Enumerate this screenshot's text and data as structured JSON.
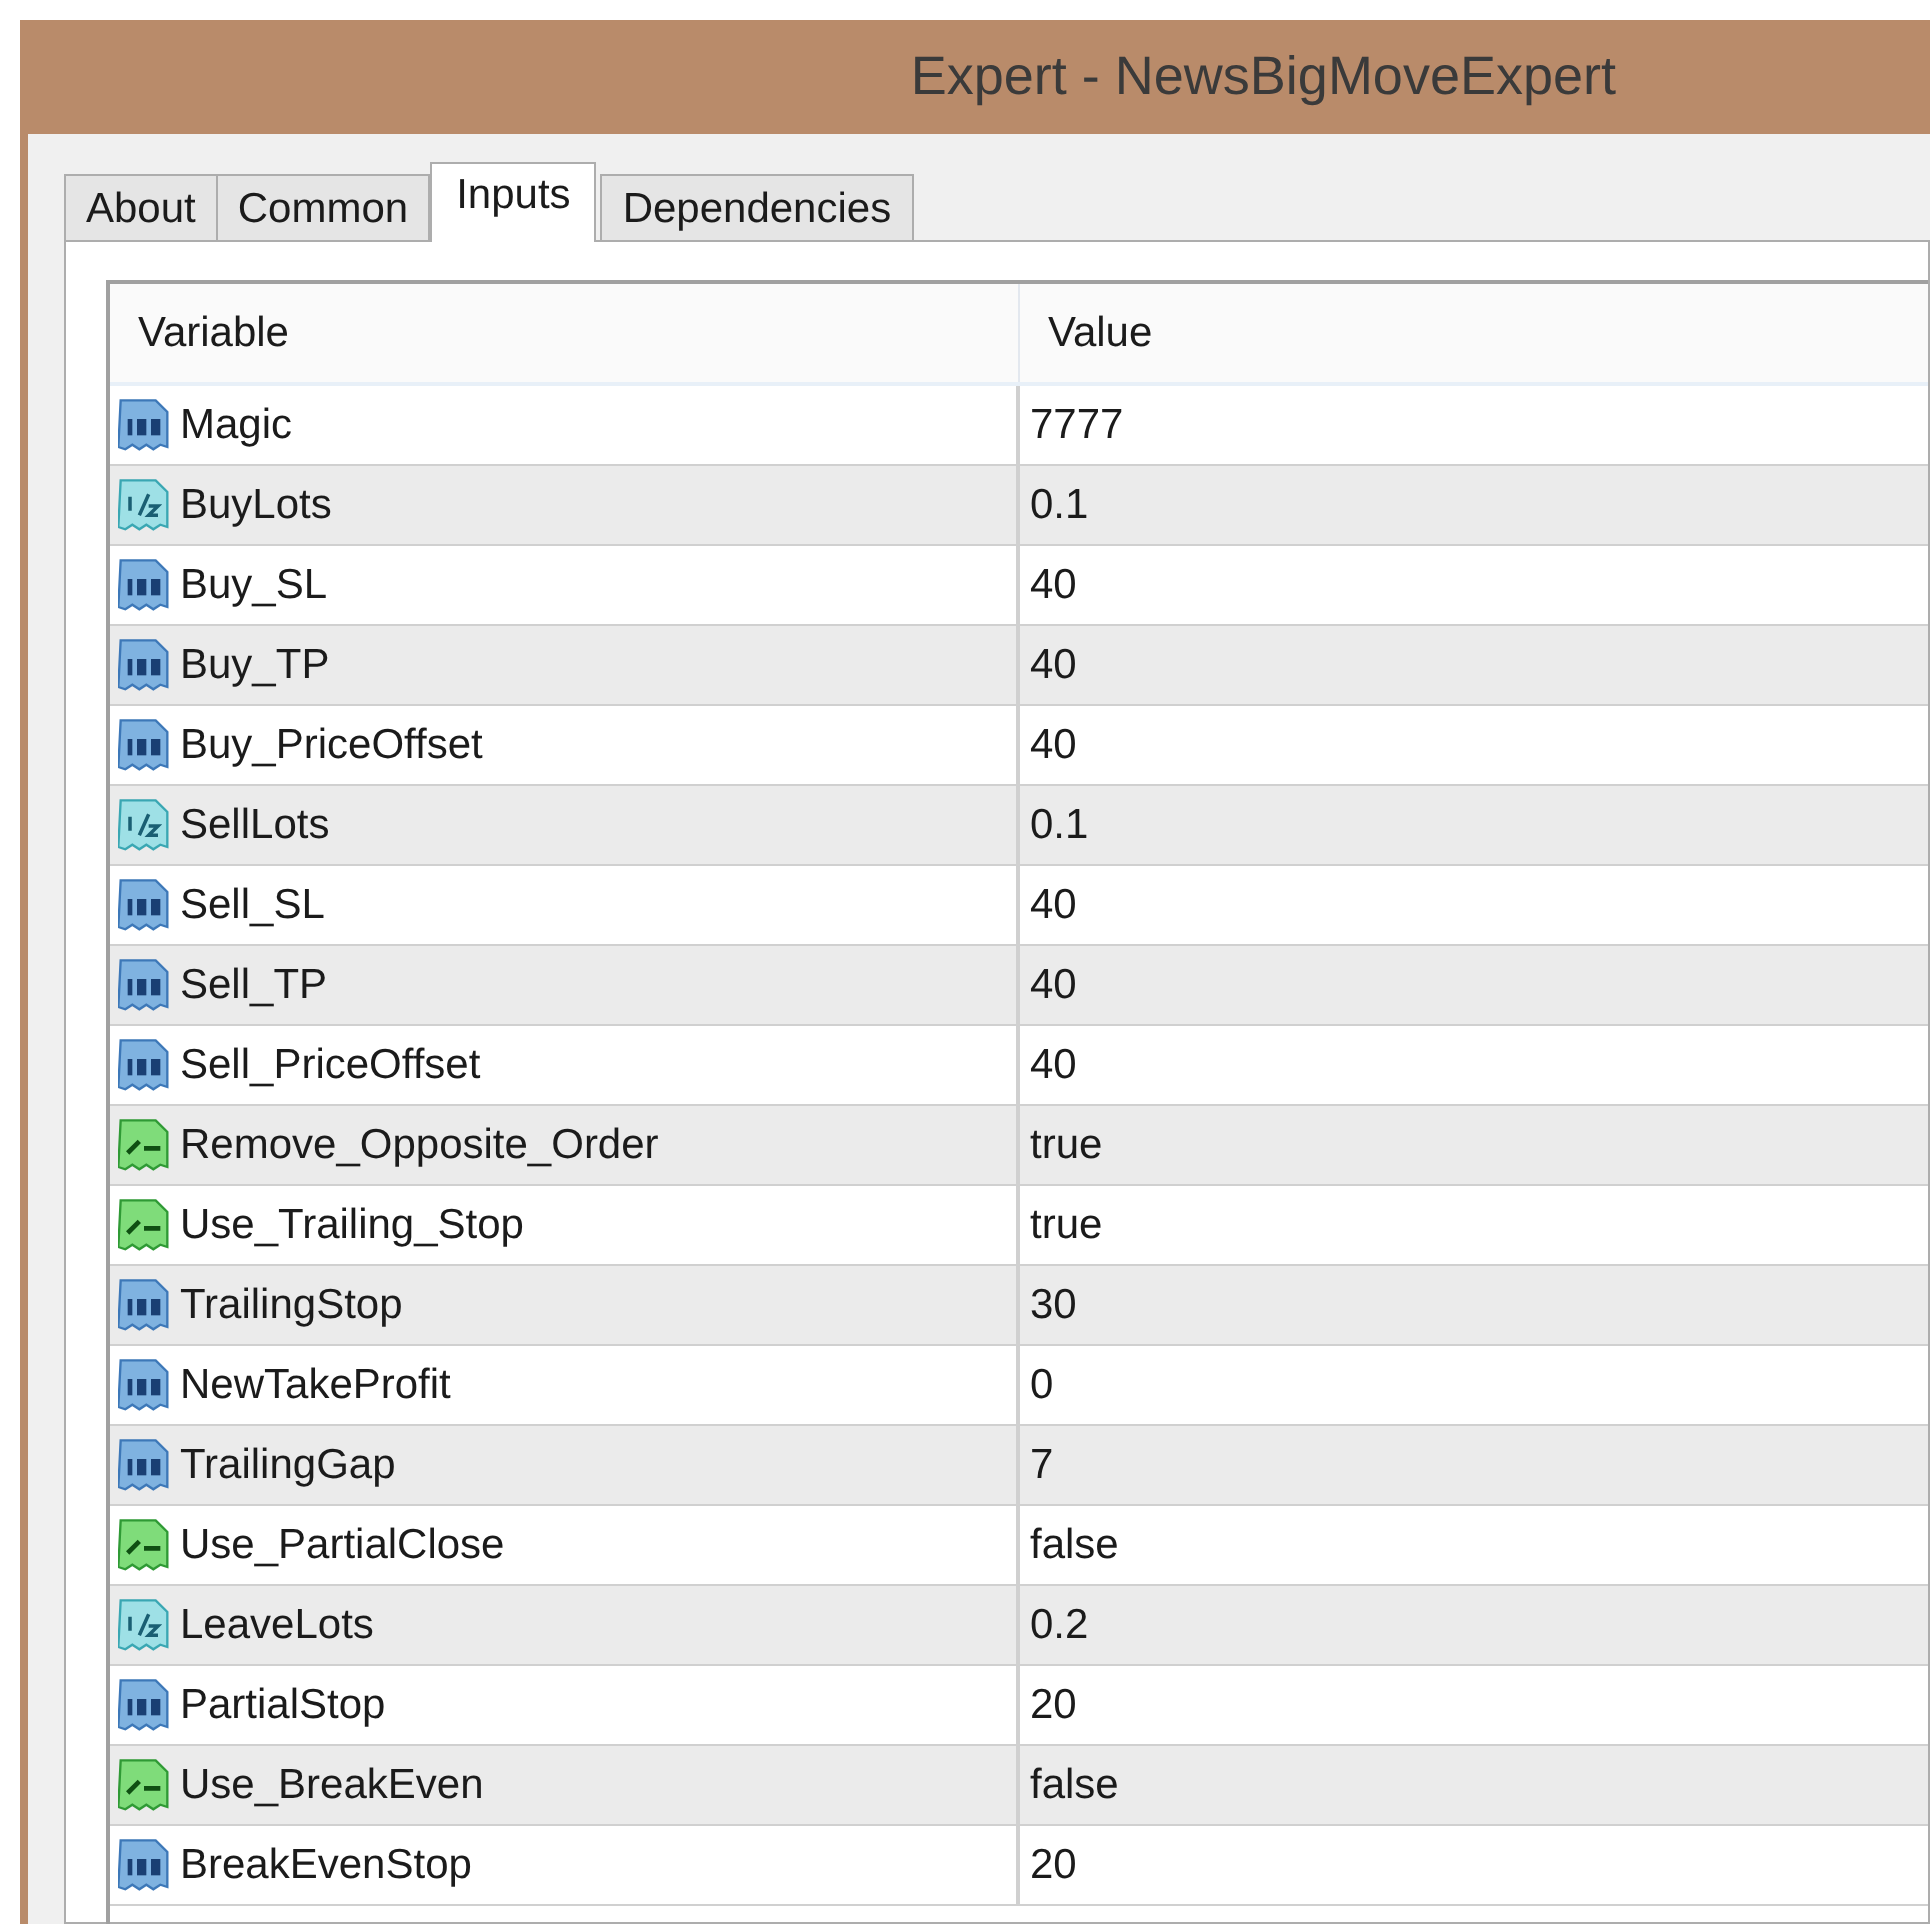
{
  "window": {
    "title": "Expert - NewsBigMoveExpert"
  },
  "tabs": [
    {
      "label": "About",
      "selected": false
    },
    {
      "label": "Common",
      "selected": false
    },
    {
      "label": "Inputs",
      "selected": true
    },
    {
      "label": "Dependencies",
      "selected": false
    }
  ],
  "table": {
    "columns": [
      "Variable",
      "Value"
    ],
    "rows": [
      {
        "kind": "int",
        "variable": "Magic",
        "value": "7777"
      },
      {
        "kind": "double",
        "variable": "BuyLots",
        "value": "0.1"
      },
      {
        "kind": "int",
        "variable": "Buy_SL",
        "value": "40"
      },
      {
        "kind": "int",
        "variable": "Buy_TP",
        "value": "40"
      },
      {
        "kind": "int",
        "variable": "Buy_PriceOffset",
        "value": "40"
      },
      {
        "kind": "double",
        "variable": "SellLots",
        "value": "0.1"
      },
      {
        "kind": "int",
        "variable": "Sell_SL",
        "value": "40"
      },
      {
        "kind": "int",
        "variable": "Sell_TP",
        "value": "40"
      },
      {
        "kind": "int",
        "variable": "Sell_PriceOffset",
        "value": "40"
      },
      {
        "kind": "bool",
        "variable": "Remove_Opposite_Order",
        "value": "true"
      },
      {
        "kind": "bool",
        "variable": "Use_Trailing_Stop",
        "value": "true"
      },
      {
        "kind": "int",
        "variable": "TrailingStop",
        "value": "30"
      },
      {
        "kind": "int",
        "variable": "NewTakeProfit",
        "value": "0"
      },
      {
        "kind": "int",
        "variable": "TrailingGap",
        "value": "7"
      },
      {
        "kind": "bool",
        "variable": "Use_PartialClose",
        "value": "false"
      },
      {
        "kind": "double",
        "variable": "LeaveLots",
        "value": "0.2"
      },
      {
        "kind": "int",
        "variable": "PartialStop",
        "value": "20"
      },
      {
        "kind": "bool",
        "variable": "Use_BreakEven",
        "value": "false"
      },
      {
        "kind": "int",
        "variable": "BreakEvenStop",
        "value": "20"
      }
    ]
  }
}
